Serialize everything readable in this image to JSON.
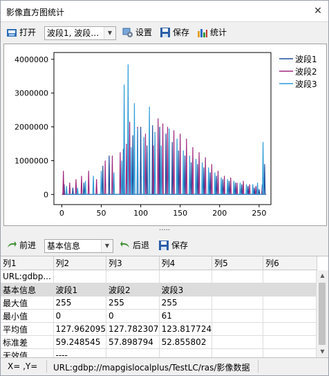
{
  "window": {
    "title": "影像直方图统计"
  },
  "toolbar": {
    "open_label": "打开",
    "band_select": "波段1, 波段…",
    "settings_label": "设置",
    "save_label": "保存",
    "stats_label": "统计"
  },
  "chart_data": {
    "type": "line",
    "xlim": [
      -10,
      265
    ],
    "ylim": [
      -300000,
      4200000
    ],
    "x_ticks": [
      "0",
      "50",
      "100",
      "150",
      "200",
      "250"
    ],
    "y_ticks": [
      "0",
      "1000000",
      "2000000",
      "3000000",
      "4000000"
    ],
    "legend": "top-right",
    "series": [
      {
        "name": "波段1",
        "color": "#1f4e9c",
        "values": [
          [
            3,
            300000
          ],
          [
            14,
            200000
          ],
          [
            28,
            350000
          ],
          [
            52,
            850000
          ],
          [
            60,
            1150000
          ],
          [
            78,
            1350000
          ],
          [
            90,
            1750000
          ],
          [
            100,
            2000000
          ],
          [
            108,
            1450000
          ],
          [
            115,
            2050000
          ],
          [
            124,
            2000000
          ],
          [
            132,
            1800000
          ],
          [
            140,
            1550000
          ],
          [
            148,
            1300000
          ],
          [
            156,
            1150000
          ],
          [
            164,
            950000
          ],
          [
            172,
            900000
          ],
          [
            180,
            800000
          ],
          [
            188,
            650000
          ],
          [
            196,
            550000
          ],
          [
            204,
            450000
          ],
          [
            212,
            400000
          ],
          [
            220,
            350000
          ],
          [
            228,
            300000
          ],
          [
            236,
            250000
          ],
          [
            244,
            200000
          ],
          [
            250,
            150000
          ],
          [
            254,
            300000
          ],
          [
            257,
            900000
          ]
        ]
      },
      {
        "name": "波段2",
        "color": "#a0287e",
        "values": [
          [
            2,
            700000
          ],
          [
            10,
            350000
          ],
          [
            18,
            450000
          ],
          [
            25,
            550000
          ],
          [
            34,
            700000
          ],
          [
            44,
            450000
          ],
          [
            55,
            1000000
          ],
          [
            64,
            1150000
          ],
          [
            74,
            1250000
          ],
          [
            82,
            1500000
          ],
          [
            86,
            2150000
          ],
          [
            96,
            2000000
          ],
          [
            106,
            1800000
          ],
          [
            116,
            1450000
          ],
          [
            122,
            2250000
          ],
          [
            128,
            2100000
          ],
          [
            134,
            2000000
          ],
          [
            142,
            1900000
          ],
          [
            150,
            1800000
          ],
          [
            158,
            1650000
          ],
          [
            166,
            1400000
          ],
          [
            174,
            1250000
          ],
          [
            182,
            1100000
          ],
          [
            190,
            900000
          ],
          [
            198,
            700000
          ],
          [
            206,
            550000
          ],
          [
            214,
            500000
          ],
          [
            222,
            350000
          ],
          [
            230,
            400000
          ],
          [
            238,
            300000
          ],
          [
            246,
            250000
          ],
          [
            254,
            200000
          ]
        ]
      },
      {
        "name": "波段3",
        "color": "#2a9bd6",
        "values": [
          [
            6,
            250000
          ],
          [
            20,
            200000
          ],
          [
            30,
            400000
          ],
          [
            40,
            550000
          ],
          [
            50,
            700000
          ],
          [
            66,
            650000
          ],
          [
            76,
            1000000
          ],
          [
            79,
            3250000
          ],
          [
            84,
            3850000
          ],
          [
            88,
            1400000
          ],
          [
            92,
            2700000
          ],
          [
            96,
            1950000
          ],
          [
            104,
            1700000
          ],
          [
            111,
            2600000
          ],
          [
            118,
            1850000
          ],
          [
            126,
            1450000
          ],
          [
            136,
            1950000
          ],
          [
            146,
            1650000
          ],
          [
            154,
            1300000
          ],
          [
            162,
            1150000
          ],
          [
            170,
            1050000
          ],
          [
            178,
            950000
          ],
          [
            186,
            800000
          ],
          [
            194,
            650000
          ],
          [
            202,
            500000
          ],
          [
            210,
            450000
          ],
          [
            218,
            400000
          ],
          [
            226,
            350000
          ],
          [
            234,
            300000
          ],
          [
            242,
            300000
          ],
          [
            248,
            350000
          ],
          [
            255,
            1550000
          ]
        ]
      }
    ]
  },
  "toolbar2": {
    "forward_label": "前进",
    "mode_select": "基本信息",
    "back_label": "后退",
    "save_label": "保存"
  },
  "table": {
    "columns": [
      "列1",
      "列2",
      "列3",
      "列4",
      "列5",
      "列6"
    ],
    "rows": [
      [
        "URL:gdbp...",
        "",
        "",
        "",
        "",
        ""
      ],
      [
        "基本信息",
        "波段1",
        "波段2",
        "波段3",
        "",
        ""
      ],
      [
        "最大值",
        "255",
        "255",
        "255",
        "",
        ""
      ],
      [
        "最小值",
        "0",
        "0",
        "61",
        "",
        ""
      ],
      [
        "平均值",
        "127.962095",
        "127.782307",
        "123.817724",
        "",
        ""
      ],
      [
        "标准差",
        "59.248545",
        "57.898794",
        "52.855802",
        "",
        ""
      ],
      [
        "无效值",
        "----",
        "",
        "",
        "",
        ""
      ]
    ]
  },
  "status": {
    "coords": "X= ,Y=",
    "url": "URL:gdbp://mapgislocalplus/TestLC/ras/影像数据"
  },
  "icons": {
    "close": "close-icon",
    "open": "folder-open-icon",
    "settings": "settings-icon",
    "save": "floppy-save-icon",
    "stats": "bar-stats-icon",
    "forward": "forward-arrow-icon",
    "back": "back-arrow-icon"
  }
}
